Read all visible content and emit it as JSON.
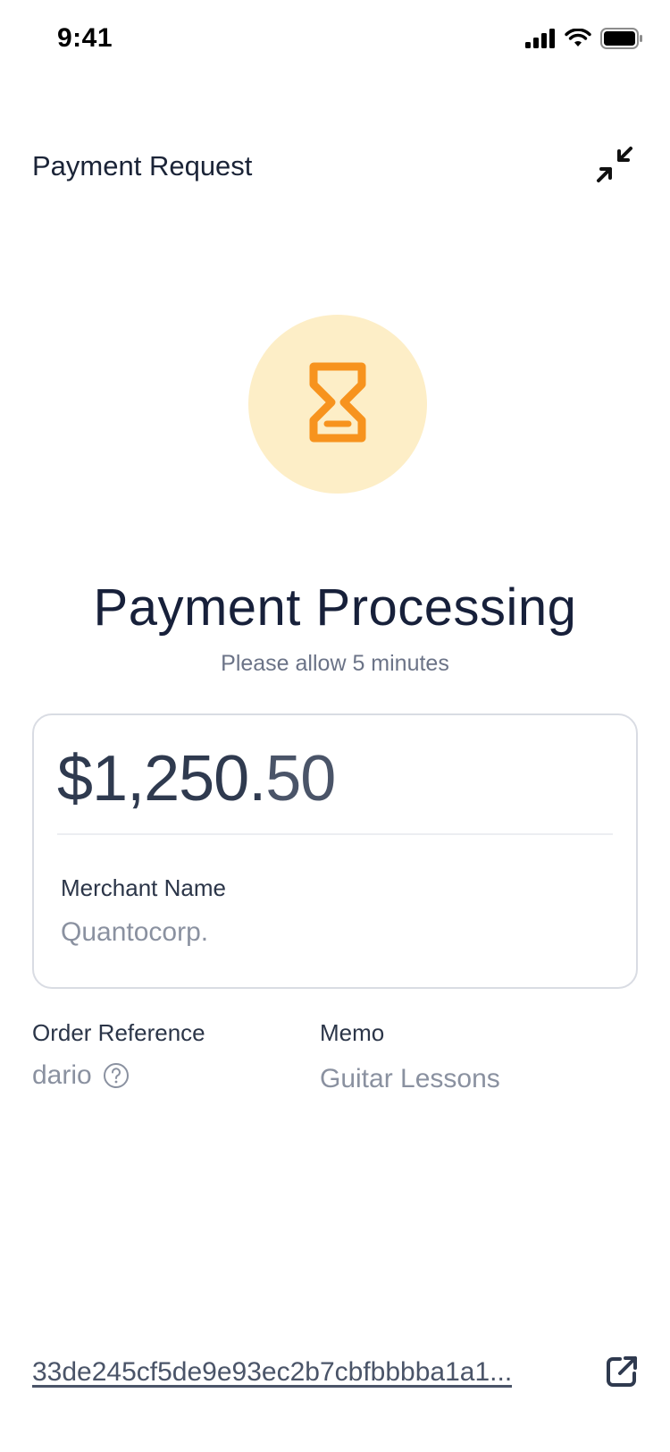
{
  "status_bar": {
    "time": "9:41",
    "icons": [
      "cellular-signal-icon",
      "wifi-icon",
      "battery-icon"
    ]
  },
  "header": {
    "title": "Payment Request",
    "collapse_icon": "collapse-arrows-icon"
  },
  "status": {
    "icon": "hourglass-icon",
    "title": "Payment Processing",
    "subtitle": "Please allow 5 minutes"
  },
  "amount": {
    "whole": "$1,250.",
    "cents": "50"
  },
  "merchant": {
    "label": "Merchant Name",
    "value": "Quantocorp."
  },
  "order_reference": {
    "label": "Order Reference",
    "value": "dario",
    "help_icon": "question-circle-icon"
  },
  "memo": {
    "label": "Memo",
    "value": "Guitar Lessons"
  },
  "transaction": {
    "link_text": "33de245cf5de9e93ec2b7cbfbbbba1a1...",
    "external_icon": "external-link-icon"
  },
  "colors": {
    "accent_orange": "#f7931e",
    "status_circle_bg": "#fdeec7",
    "text_dark": "#17203a",
    "text_muted": "#8a91a0"
  }
}
